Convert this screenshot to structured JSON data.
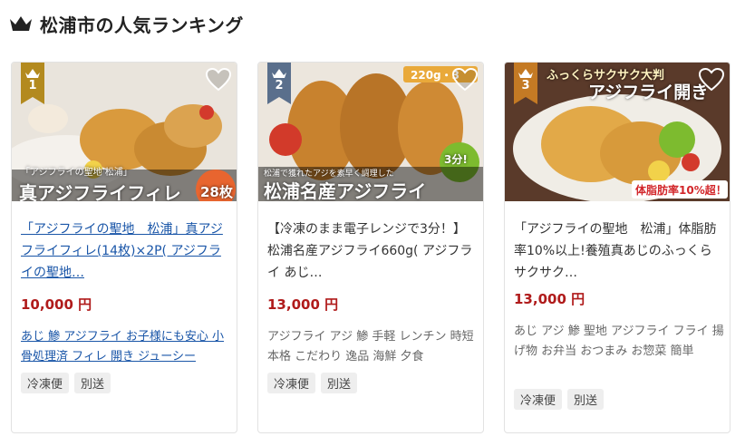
{
  "header": {
    "title": "松浦市の人気ランキング",
    "icon": "crown-icon"
  },
  "colors": {
    "rank_gold": "#b38a1f",
    "rank_silver": "#5a6f8c",
    "rank_bronze": "#c47a24",
    "price": "#b01b1b",
    "link": "#1a56a8"
  },
  "cards": [
    {
      "rank": "1",
      "image": {
        "overlay_title": "真アジフライフィレ",
        "overlay_sub": "「アジフライの聖地 松浦」",
        "count_badge": "28枚"
      },
      "title": "「アジフライの聖地　松浦」真アジフライフィレ(14枚)×2P( アジフライの聖地…",
      "price": "10,000 円",
      "tags": "あじ 鯵 アジフライ お子様にも安心 小骨処理済 フィレ 開き ジューシー",
      "badges": [
        "冷凍便",
        "別送"
      ]
    },
    {
      "rank": "2",
      "image": {
        "overlay_title": "松浦名産アジフライ",
        "overlay_sub": "松浦で獲れたアジを素早く調理した",
        "weight_badge": "220g・3",
        "time_badge": "3分!"
      },
      "title": "【冷凍のまま電子レンジで3分！】松浦名産アジフライ660g( アジフライ あじ…",
      "price": "13,000 円",
      "tags": "アジフライ アジ 鯵 手軽 レンチン 時短 本格 こだわり 逸品 海鮮 夕食",
      "badges": [
        "冷凍便",
        "別送"
      ]
    },
    {
      "rank": "3",
      "image": {
        "overlay_top": "ふっくらサクサク大判",
        "overlay_title": "アジフライ開き",
        "fat_badge": "体脂肪率10%超！"
      },
      "title": "「アジフライの聖地　松浦」体脂肪率10%以上!養殖真あじのふっくらサクサク…",
      "price": "13,000 円",
      "tags": "あじ アジ 鯵 聖地 アジフライ フライ 揚げ物 お弁当 おつまみ お惣菜 簡単",
      "badges": [
        "冷凍便",
        "別送"
      ]
    }
  ]
}
